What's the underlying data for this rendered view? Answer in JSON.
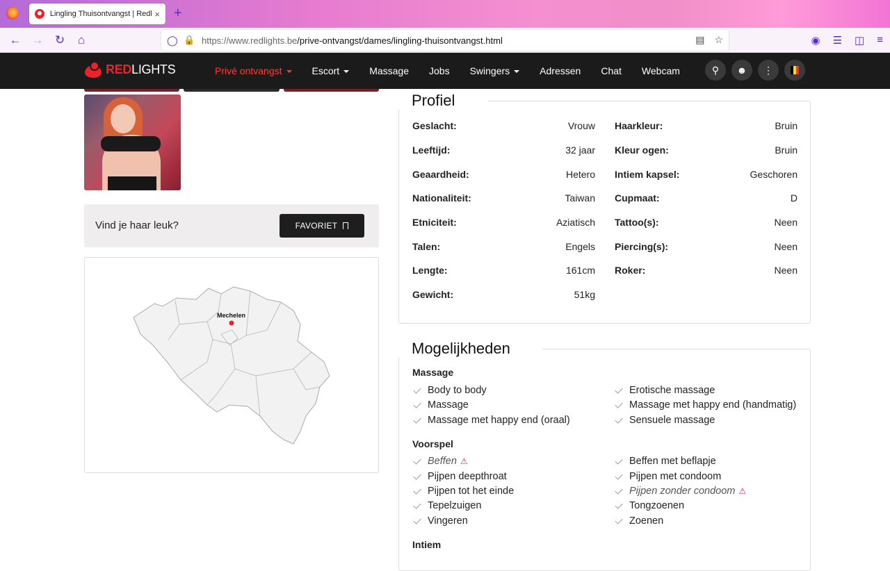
{
  "browser": {
    "tab_title": "Lingling Thuisontvangst | Redlights",
    "tab_close": "×",
    "new_tab": "+",
    "url_host": "https://www.redlights.be",
    "url_path": "/prive-ontvangst/dames/lingling-thuisontvangst.html"
  },
  "site": {
    "logo_red": "RED",
    "logo_white": "LIGHTS",
    "menu": [
      {
        "label": "Privé ontvangst"
      },
      {
        "label": "Escort"
      },
      {
        "label": "Massage"
      },
      {
        "label": "Jobs"
      },
      {
        "label": "Swingers"
      },
      {
        "label": "Adressen"
      },
      {
        "label": "Chat"
      },
      {
        "label": "Webcam"
      }
    ],
    "accent_color": "#e8242a"
  },
  "left": {
    "like_text": "Vind je haar leuk?",
    "favoriet_label": "FAVORIET",
    "map_city": "Mechelen"
  },
  "profile": {
    "title": "Profiel",
    "left": [
      {
        "k": "Geslacht:",
        "v": "Vrouw"
      },
      {
        "k": "Leeftijd:",
        "v": "32 jaar"
      },
      {
        "k": "Geaardheid:",
        "v": "Hetero"
      },
      {
        "k": "Nationaliteit:",
        "v": "Taiwan"
      },
      {
        "k": "Etniciteit:",
        "v": "Aziatisch"
      },
      {
        "k": "Talen:",
        "v": "Engels"
      },
      {
        "k": "Lengte:",
        "v": "161cm"
      },
      {
        "k": "Gewicht:",
        "v": "51kg"
      }
    ],
    "right": [
      {
        "k": "Haarkleur:",
        "v": "Bruin"
      },
      {
        "k": "Kleur ogen:",
        "v": "Bruin"
      },
      {
        "k": "Intiem kapsel:",
        "v": "Geschoren"
      },
      {
        "k": "Cupmaat:",
        "v": "D"
      },
      {
        "k": "Tattoo(s):",
        "v": "Neen"
      },
      {
        "k": "Piercing(s):",
        "v": "Neen"
      },
      {
        "k": "Roker:",
        "v": "Neen"
      }
    ]
  },
  "options": {
    "title": "Mogelijkheden",
    "massage": {
      "head": "Massage",
      "left": [
        "Body to body",
        "Massage",
        "Massage met happy end (oraal)"
      ],
      "right": [
        "Erotische massage",
        "Massage met happy end (handmatig)",
        "Sensuele massage"
      ]
    },
    "voorspel": {
      "head": "Voorspel",
      "left": [
        "Beffen",
        "Pijpen deepthroat",
        "Pijpen tot het einde",
        "Tepelzuigen",
        "Vingeren"
      ],
      "right": [
        "Beffen met beflapje",
        "Pijpen met condoom",
        "Pijpen zonder condoom",
        "Tongzoenen",
        "Zoenen"
      ]
    },
    "intiem": {
      "head": "Intiem"
    }
  }
}
